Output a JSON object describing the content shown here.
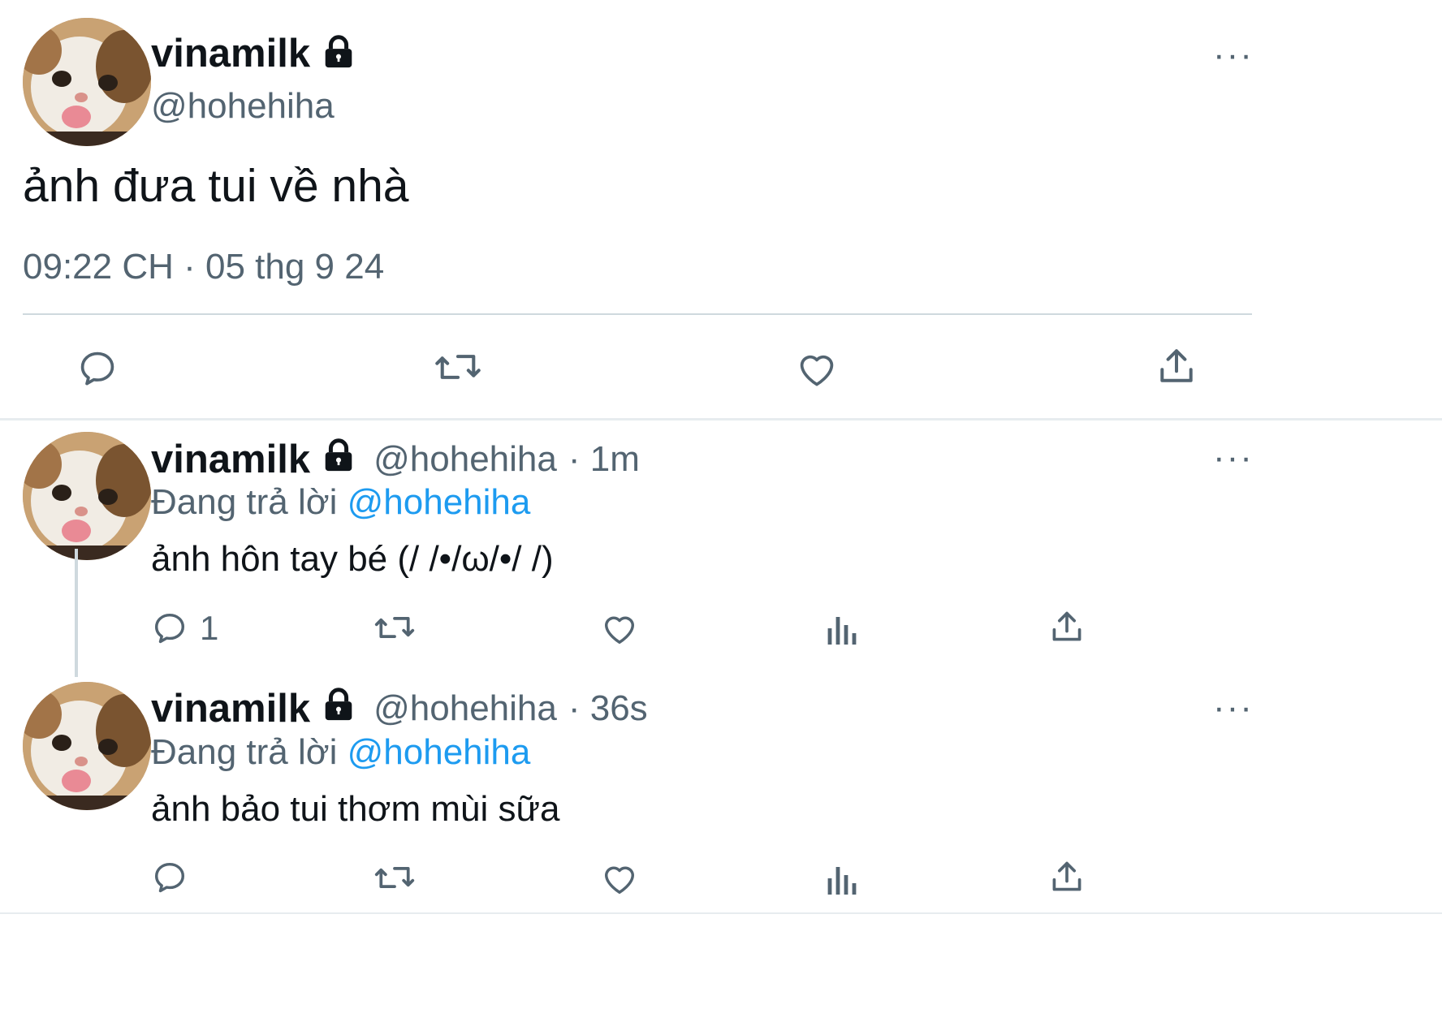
{
  "main_tweet": {
    "display_name": "vinamilk",
    "handle": "@hohehiha",
    "text": "ảnh đưa tui về nhà",
    "timestamp": "09:22 CH · 05 thg 9 24",
    "more_label": "···",
    "actions": [
      "reply-icon",
      "retweet-icon",
      "like-icon",
      "share-icon"
    ]
  },
  "replies": [
    {
      "display_name": "vinamilk",
      "handle": "@hohehiha",
      "time": "· 1m",
      "replying_prefix": "Đang trả lời",
      "replying_to": "@hohehiha",
      "text": "ảnh hôn tay bé (/ /•/ω/•/ /)",
      "reply_count": "1",
      "more_label": "···"
    },
    {
      "display_name": "vinamilk",
      "handle": "@hohehiha",
      "time": "· 36s",
      "replying_prefix": "Đang trả lời",
      "replying_to": "@hohehiha",
      "text": "ảnh bảo tui thơm mùi sữa",
      "reply_count": "",
      "more_label": "···"
    }
  ],
  "colors": {
    "text": "#0f1419",
    "secondary": "#536471",
    "link": "#1d9bf0",
    "divider": "#cfd9de"
  }
}
